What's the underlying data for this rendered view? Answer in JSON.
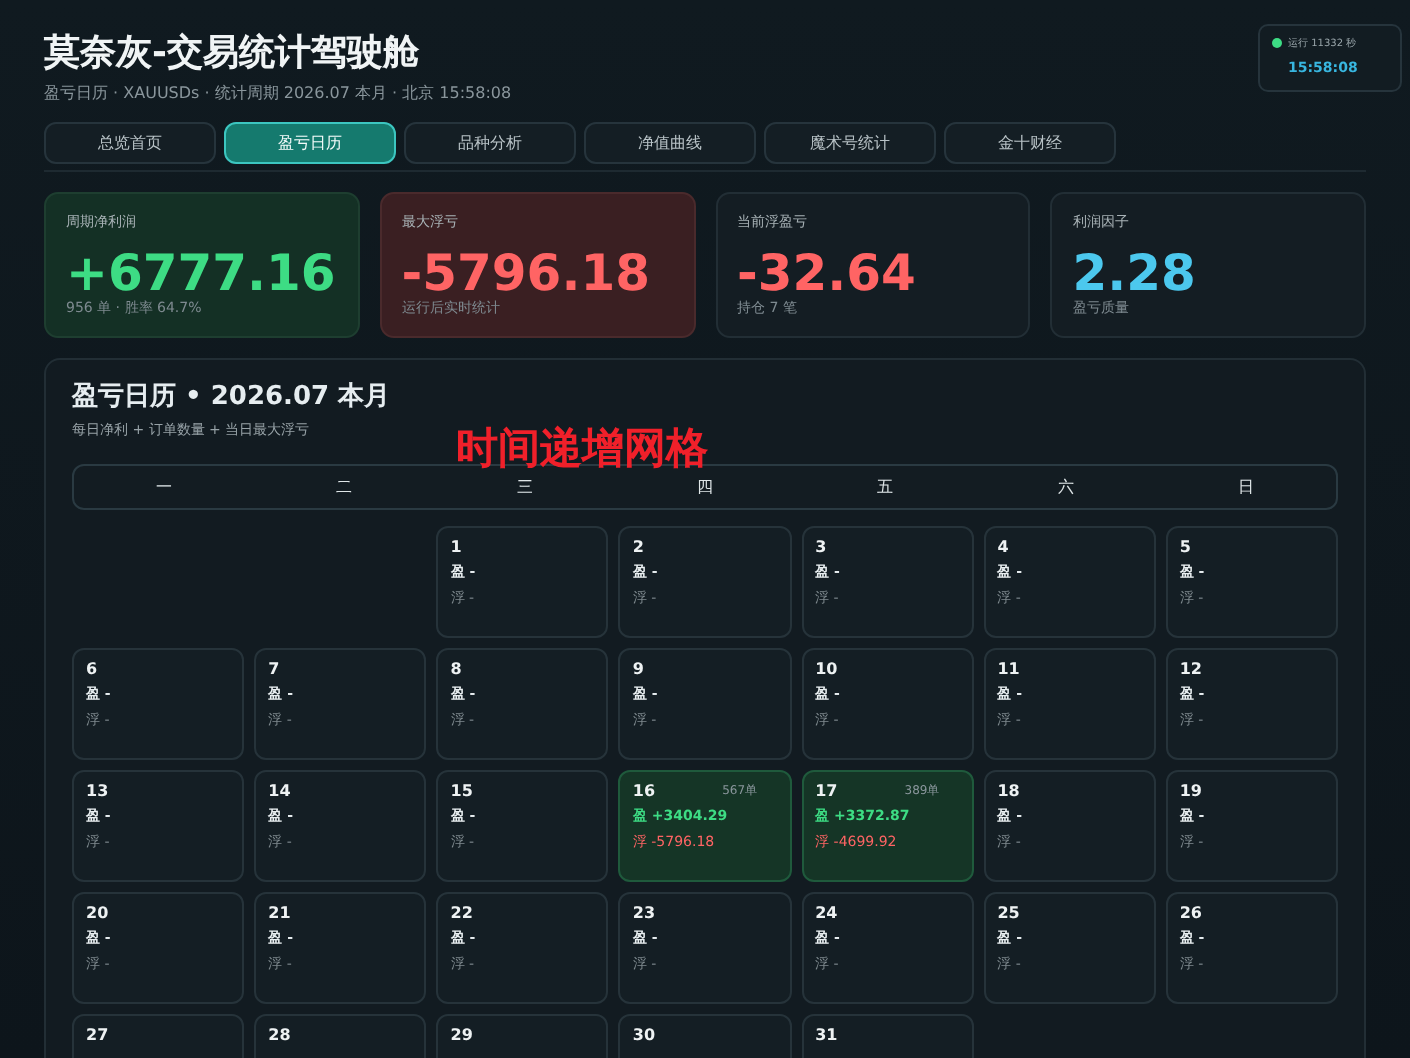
{
  "header": {
    "title": "莫奈灰-交易统计驾驶舱",
    "subtitle": "盈亏日历 · XAUUSDs · 统计周期 2026.07 本月 · 北京 15:58:08"
  },
  "status": {
    "online": true,
    "uptime": "运行 11332 秒",
    "time": "15:58:08"
  },
  "tabs": [
    {
      "label": "总览首页",
      "selected": false
    },
    {
      "label": "盈亏日历",
      "selected": true
    },
    {
      "label": "品种分析",
      "selected": false
    },
    {
      "label": "净值曲线",
      "selected": false
    },
    {
      "label": "魔术号统计",
      "selected": false
    },
    {
      "label": "金十财经",
      "selected": false
    }
  ],
  "stats": [
    {
      "label": "周期净利润",
      "value": "+6777.16",
      "note": "956 单 · 胜率 64.7%",
      "kind": "positive"
    },
    {
      "label": "最大浮亏",
      "value": "-5796.18",
      "note": "运行后实时统计",
      "kind": "danger"
    },
    {
      "label": "当前浮盈亏",
      "value": "-32.64",
      "note": "持仓 7 笔",
      "kind": "negative"
    },
    {
      "label": "利润因子",
      "value": "2.28",
      "note": "盈亏质量",
      "kind": "info"
    }
  ],
  "calendar": {
    "title": "盈亏日历 • 2026.07 本月",
    "subtitle": "每日净利 + 订单数量 + 当日最大浮亏",
    "overlay": "时间递增网格",
    "weekdays": [
      "一",
      "二",
      "三",
      "四",
      "五",
      "六",
      "日"
    ],
    "days": [
      {
        "kind": "blank"
      },
      {
        "kind": "blank"
      },
      {
        "kind": "day",
        "day": "1",
        "profit": "盈 -",
        "float": "浮 -",
        "active": false
      },
      {
        "kind": "day",
        "day": "2",
        "profit": "盈 -",
        "float": "浮 -",
        "active": false
      },
      {
        "kind": "day",
        "day": "3",
        "profit": "盈 -",
        "float": "浮 -",
        "active": false
      },
      {
        "kind": "day",
        "day": "4",
        "profit": "盈 -",
        "float": "浮 -",
        "active": false
      },
      {
        "kind": "day",
        "day": "5",
        "profit": "盈 -",
        "float": "浮 -",
        "active": false
      },
      {
        "kind": "day",
        "day": "6",
        "profit": "盈 -",
        "float": "浮 -",
        "active": false
      },
      {
        "kind": "day",
        "day": "7",
        "profit": "盈 -",
        "float": "浮 -",
        "active": false
      },
      {
        "kind": "day",
        "day": "8",
        "profit": "盈 -",
        "float": "浮 -",
        "active": false
      },
      {
        "kind": "day",
        "day": "9",
        "profit": "盈 -",
        "float": "浮 -",
        "active": false
      },
      {
        "kind": "day",
        "day": "10",
        "profit": "盈 -",
        "float": "浮 -",
        "active": false
      },
      {
        "kind": "day",
        "day": "11",
        "profit": "盈 -",
        "float": "浮 -",
        "active": false
      },
      {
        "kind": "day",
        "day": "12",
        "profit": "盈 -",
        "float": "浮 -",
        "active": false
      },
      {
        "kind": "day",
        "day": "13",
        "profit": "盈 -",
        "float": "浮 -",
        "active": false
      },
      {
        "kind": "day",
        "day": "14",
        "profit": "盈 -",
        "float": "浮 -",
        "active": false
      },
      {
        "kind": "day",
        "day": "15",
        "profit": "盈 -",
        "float": "浮 -",
        "active": false
      },
      {
        "kind": "day",
        "day": "16",
        "orders": "567单",
        "profit": "盈 +3404.29",
        "float": "浮 -5796.18",
        "active": true
      },
      {
        "kind": "day",
        "day": "17",
        "orders": "389单",
        "profit": "盈 +3372.87",
        "float": "浮 -4699.92",
        "active": true
      },
      {
        "kind": "day",
        "day": "18",
        "profit": "盈 -",
        "float": "浮 -",
        "active": false
      },
      {
        "kind": "day",
        "day": "19",
        "profit": "盈 -",
        "float": "浮 -",
        "active": false
      },
      {
        "kind": "day",
        "day": "20",
        "profit": "盈 -",
        "float": "浮 -",
        "active": false
      },
      {
        "kind": "day",
        "day": "21",
        "profit": "盈 -",
        "float": "浮 -",
        "active": false
      },
      {
        "kind": "day",
        "day": "22",
        "profit": "盈 -",
        "float": "浮 -",
        "active": false
      },
      {
        "kind": "day",
        "day": "23",
        "profit": "盈 -",
        "float": "浮 -",
        "active": false
      },
      {
        "kind": "day",
        "day": "24",
        "profit": "盈 -",
        "float": "浮 -",
        "active": false
      },
      {
        "kind": "day",
        "day": "25",
        "profit": "盈 -",
        "float": "浮 -",
        "active": false
      },
      {
        "kind": "day",
        "day": "26",
        "profit": "盈 -",
        "float": "浮 -",
        "active": false
      },
      {
        "kind": "day",
        "day": "27",
        "active": false
      },
      {
        "kind": "day",
        "day": "28",
        "active": false
      },
      {
        "kind": "day",
        "day": "29",
        "active": false
      },
      {
        "kind": "day",
        "day": "30",
        "active": false
      },
      {
        "kind": "day",
        "day": "31",
        "active": false
      }
    ]
  }
}
